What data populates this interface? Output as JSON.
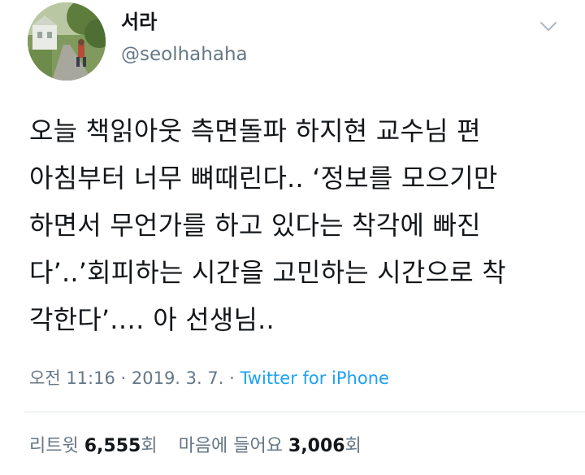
{
  "user": {
    "display_name": "서라",
    "handle": "@seolhahaha"
  },
  "tweet": {
    "lines": [
      "오늘 책읽아웃 측면돌파 하지현 교수님 편",
      "아침부터 너무 뼈때린다.. ‘정보를 모으기만",
      "하면서 무언가를 하고 있다는 착각에 빠진",
      "다’..’회피하는 시간을 고민하는 시간으로 착",
      "각한다’.… 아 선생님.."
    ]
  },
  "meta": {
    "timestamp": "오전 11:16 · 2019. 3. 7. ·",
    "source": "Twitter for iPhone"
  },
  "stats": {
    "retweets_label": "리트윗",
    "retweets_count": "6,555",
    "retweets_unit": "회",
    "likes_label": "마음에 들어요",
    "likes_count": "3,006",
    "likes_unit": "회"
  },
  "icons": {
    "menu": "chevron-down-icon",
    "avatar": "profile-photo"
  },
  "colors": {
    "text": "#14171a",
    "secondary": "#657786",
    "link": "#1da1f2",
    "divider": "#e1e8ed"
  }
}
